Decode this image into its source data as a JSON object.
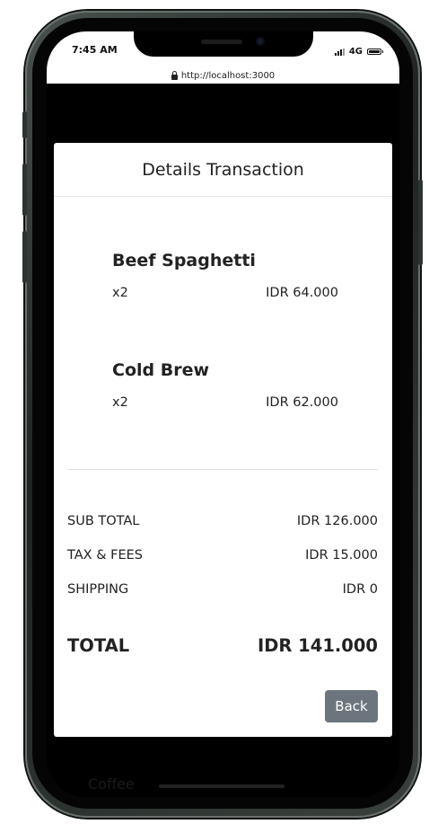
{
  "status_bar": {
    "time": "7:45 AM",
    "network": "4G"
  },
  "browser": {
    "url": "http://localhost:3000"
  },
  "background": {
    "footer_text": "Coffee"
  },
  "modal": {
    "title": "Details Transaction",
    "items": [
      {
        "name": "Beef Spaghetti",
        "qty": "x2",
        "price": "IDR 64.000"
      },
      {
        "name": "Cold Brew",
        "qty": "x2",
        "price": "IDR 62.000"
      }
    ],
    "summary": {
      "subtotal_label": "SUB TOTAL",
      "subtotal_value": "IDR 126.000",
      "tax_label": "TAX & FEES",
      "tax_value": "IDR 15.000",
      "shipping_label": "SHIPPING",
      "shipping_value": "IDR 0",
      "total_label": "TOTAL",
      "total_value": "IDR 141.000"
    },
    "back_label": "Back"
  },
  "colors": {
    "back_button": "#6c757d",
    "modal_bg": "#ffffff",
    "backdrop": "#000000"
  }
}
